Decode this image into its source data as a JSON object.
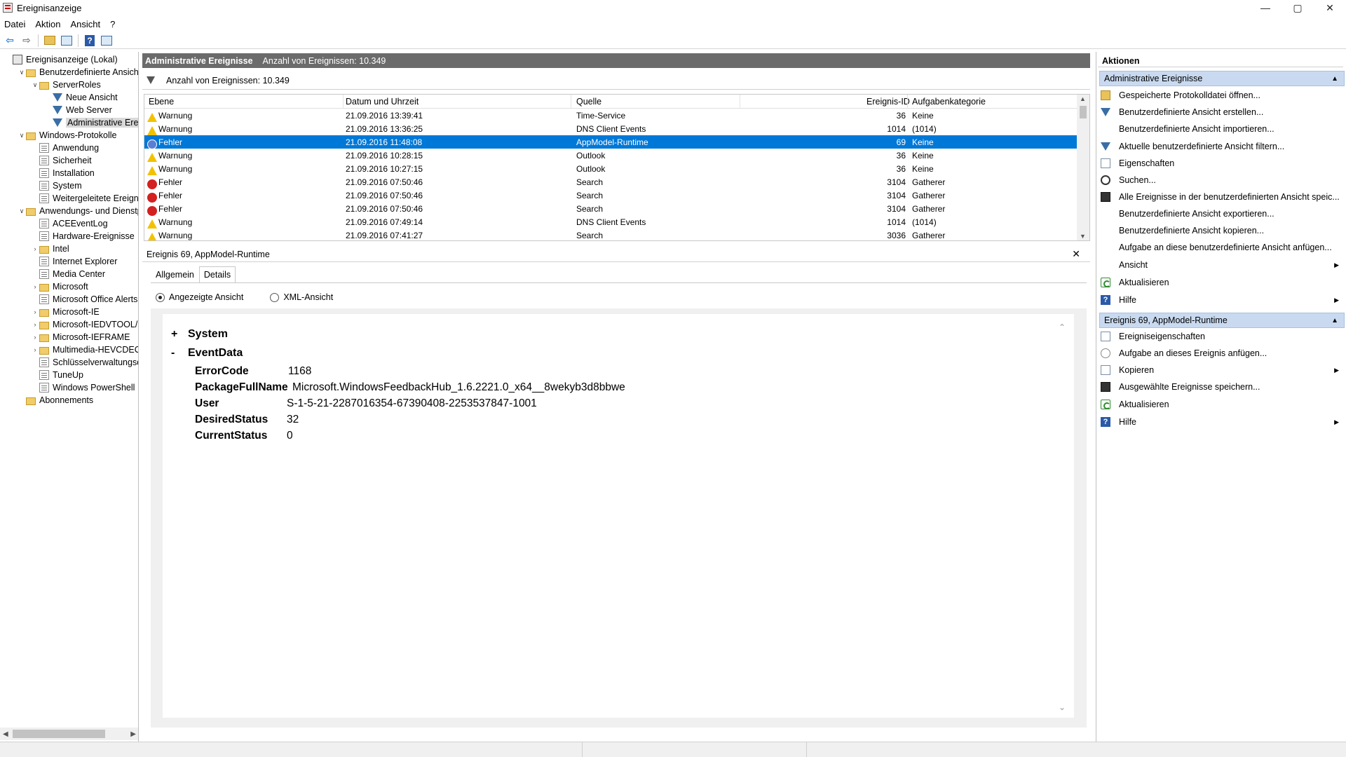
{
  "window": {
    "title": "Ereignisanzeige",
    "controls": {
      "minimize": "—",
      "maximize": "▢",
      "close": "✕"
    }
  },
  "menu": [
    "Datei",
    "Aktion",
    "Ansicht",
    "?"
  ],
  "tree": {
    "items": [
      {
        "label": "Ereignisanzeige (Lokal)",
        "icon": "event-viewer-icon",
        "expander": ""
      },
      {
        "label": "Benutzerdefinierte Ansichten",
        "icon": "folder-icon",
        "expander": "v"
      },
      {
        "label": "ServerRoles",
        "icon": "folder-icon",
        "expander": "v"
      },
      {
        "label": "Neue Ansicht",
        "icon": "filter-icon",
        "expander": ""
      },
      {
        "label": "Web Server",
        "icon": "filter-icon",
        "expander": ""
      },
      {
        "label": "Administrative Ereignisse",
        "icon": "filter-icon",
        "expander": ""
      },
      {
        "label": "Windows-Protokolle",
        "icon": "folder-icon",
        "expander": "v"
      },
      {
        "label": "Anwendung",
        "icon": "log-icon",
        "expander": ""
      },
      {
        "label": "Sicherheit",
        "icon": "log-icon",
        "expander": ""
      },
      {
        "label": "Installation",
        "icon": "log-icon",
        "expander": ""
      },
      {
        "label": "System",
        "icon": "log-icon",
        "expander": ""
      },
      {
        "label": "Weitergeleitete Ereignisse",
        "icon": "log-icon",
        "expander": ""
      },
      {
        "label": "Anwendungs- und Dienstprotokolle",
        "icon": "folder-icon",
        "expander": "v"
      },
      {
        "label": "ACEEventLog",
        "icon": "log-icon",
        "expander": ""
      },
      {
        "label": "Hardware-Ereignisse",
        "icon": "log-icon",
        "expander": ""
      },
      {
        "label": "Intel",
        "icon": "folder-icon",
        "expander": ">"
      },
      {
        "label": "Internet Explorer",
        "icon": "log-icon",
        "expander": ""
      },
      {
        "label": "Media Center",
        "icon": "log-icon",
        "expander": ""
      },
      {
        "label": "Microsoft",
        "icon": "folder-icon",
        "expander": ">"
      },
      {
        "label": "Microsoft Office Alerts",
        "icon": "log-icon",
        "expander": ""
      },
      {
        "label": "Microsoft-IE",
        "icon": "folder-icon",
        "expander": ">"
      },
      {
        "label": "Microsoft-IEDVTOOL/Diagnostic",
        "icon": "folder-icon",
        "expander": ">"
      },
      {
        "label": "Microsoft-IEFRAME",
        "icon": "folder-icon",
        "expander": ">"
      },
      {
        "label": "Multimedia-HEVCDECODER",
        "icon": "folder-icon",
        "expander": ">"
      },
      {
        "label": "Schlüsselverwaltungsdienst",
        "icon": "log-icon",
        "expander": ""
      },
      {
        "label": "TuneUp",
        "icon": "log-icon",
        "expander": ""
      },
      {
        "label": "Windows PowerShell",
        "icon": "log-icon",
        "expander": ""
      },
      {
        "label": "Abonnements",
        "icon": "subscriptions-icon",
        "expander": ""
      }
    ],
    "selected_label": "Administrative Ereignisse"
  },
  "center": {
    "header_title": "Administrative Ereignisse",
    "header_count": "Anzahl von Ereignissen: 10.349",
    "filter_count": "Anzahl von Ereignissen: 10.349",
    "columns": [
      "Ebene",
      "Datum und Uhrzeit",
      "Quelle",
      "Ereignis-ID",
      "Aufgabenkategorie"
    ],
    "rows": [
      {
        "level": "Warnung",
        "datetime": "21.09.2016 13:39:41",
        "source": "Time-Service",
        "id": "36",
        "category": "Keine"
      },
      {
        "level": "Warnung",
        "datetime": "21.09.2016 13:36:25",
        "source": "DNS Client Events",
        "id": "1014",
        "category": "(1014)"
      },
      {
        "level": "Fehler",
        "datetime": "21.09.2016 11:48:08",
        "source": "AppModel-Runtime",
        "id": "69",
        "category": "Keine"
      },
      {
        "level": "Warnung",
        "datetime": "21.09.2016 10:28:15",
        "source": "Outlook",
        "id": "36",
        "category": "Keine"
      },
      {
        "level": "Warnung",
        "datetime": "21.09.2016 10:27:15",
        "source": "Outlook",
        "id": "36",
        "category": "Keine"
      },
      {
        "level": "Fehler",
        "datetime": "21.09.2016 07:50:46",
        "source": "Search",
        "id": "3104",
        "category": "Gatherer"
      },
      {
        "level": "Fehler",
        "datetime": "21.09.2016 07:50:46",
        "source": "Search",
        "id": "3104",
        "category": "Gatherer"
      },
      {
        "level": "Fehler",
        "datetime": "21.09.2016 07:50:46",
        "source": "Search",
        "id": "3104",
        "category": "Gatherer"
      },
      {
        "level": "Warnung",
        "datetime": "21.09.2016 07:49:14",
        "source": "DNS Client Events",
        "id": "1014",
        "category": "(1014)"
      },
      {
        "level": "Warnung",
        "datetime": "21.09.2016 07:41:27",
        "source": "Search",
        "id": "3036",
        "category": "Gatherer"
      }
    ],
    "selected_row": 2
  },
  "detail": {
    "title": "Ereignis 69, AppModel-Runtime",
    "close": "✕",
    "tabs": [
      "Allgemein",
      "Details"
    ],
    "active_tab": "Details",
    "radio_friendly": "Angezeigte Ansicht",
    "radio_xml": "XML-Ansicht",
    "system_sign": "+",
    "system_label": "System",
    "eventdata_sign": "-",
    "eventdata_label": "EventData",
    "fields": [
      {
        "key": "ErrorCode",
        "value": "1168"
      },
      {
        "key": "PackageFullName",
        "value": "Microsoft.WindowsFeedbackHub_1.6.2221.0_x64__8wekyb3d8bbwe"
      },
      {
        "key": "User",
        "value": "S-1-5-21-2287016354-67390408-2253537847-1001"
      },
      {
        "key": "DesiredStatus",
        "value": "32"
      },
      {
        "key": "CurrentStatus",
        "value": "0"
      }
    ]
  },
  "actions": {
    "title": "Aktionen",
    "section1": "Administrative Ereignisse",
    "section1_items": [
      {
        "label": "Gespeicherte Protokolldatei öffnen...",
        "icon": "open-log-icon",
        "submenu": false
      },
      {
        "label": "Benutzerdefinierte Ansicht erstellen...",
        "icon": "filter-icon",
        "submenu": false
      },
      {
        "label": "Benutzerdefinierte Ansicht importieren...",
        "icon": "",
        "submenu": false
      },
      {
        "label": "Aktuelle benutzerdefinierte Ansicht filtern...",
        "icon": "filter-icon",
        "submenu": false
      },
      {
        "label": "Eigenschaften",
        "icon": "properties-icon",
        "submenu": false
      },
      {
        "label": "Suchen...",
        "icon": "find-icon",
        "submenu": false
      },
      {
        "label": "Alle Ereignisse in der benutzerdefinierten Ansicht speic...",
        "icon": "save-icon",
        "submenu": false
      },
      {
        "label": "Benutzerdefinierte Ansicht exportieren...",
        "icon": "",
        "submenu": false
      },
      {
        "label": "Benutzerdefinierte Ansicht kopieren...",
        "icon": "",
        "submenu": false
      },
      {
        "label": "Aufgabe an diese benutzerdefinierte Ansicht anfügen...",
        "icon": "",
        "submenu": false
      },
      {
        "label": "Ansicht",
        "icon": "",
        "submenu": true
      },
      {
        "label": "Aktualisieren",
        "icon": "refresh-icon",
        "submenu": false
      },
      {
        "label": "Hilfe",
        "icon": "help-icon",
        "submenu": true
      }
    ],
    "section2": "Ereignis 69, AppModel-Runtime",
    "section2_items": [
      {
        "label": "Ereigniseigenschaften",
        "icon": "properties-icon",
        "submenu": false
      },
      {
        "label": "Aufgabe an dieses Ereignis anfügen...",
        "icon": "task-icon",
        "submenu": false
      },
      {
        "label": "Kopieren",
        "icon": "copy-icon",
        "submenu": true
      },
      {
        "label": "Ausgewählte Ereignisse speichern...",
        "icon": "save-icon",
        "submenu": false
      },
      {
        "label": "Aktualisieren",
        "icon": "refresh-icon",
        "submenu": false
      },
      {
        "label": "Hilfe",
        "icon": "help-icon",
        "submenu": true
      }
    ]
  }
}
